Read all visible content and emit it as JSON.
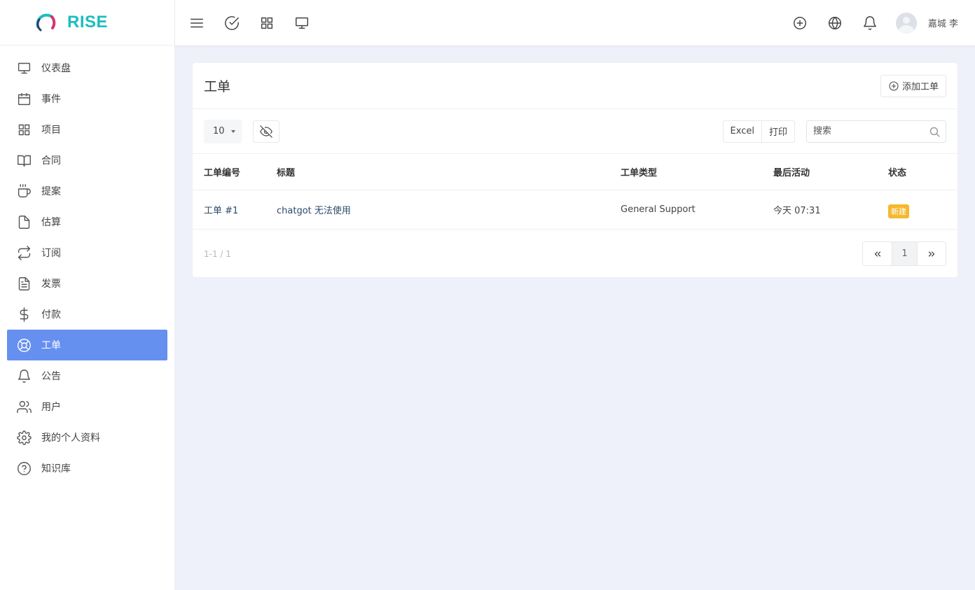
{
  "brand": {
    "name": "RISE",
    "colors": {
      "teal": "#1bbdbf",
      "accent": "#6690f0",
      "badge": "#f5b82e"
    }
  },
  "sidebar": {
    "items": [
      {
        "label": "仪表盘",
        "icon": "monitor-icon"
      },
      {
        "label": "事件",
        "icon": "calendar-icon"
      },
      {
        "label": "项目",
        "icon": "grid-icon"
      },
      {
        "label": "合同",
        "icon": "book-icon"
      },
      {
        "label": "提案",
        "icon": "coffee-icon"
      },
      {
        "label": "估算",
        "icon": "file-icon"
      },
      {
        "label": "订阅",
        "icon": "repeat-icon"
      },
      {
        "label": "发票",
        "icon": "file-text-icon"
      },
      {
        "label": "付款",
        "icon": "dollar-icon"
      },
      {
        "label": "工单",
        "icon": "life-buoy-icon",
        "active": true
      },
      {
        "label": "公告",
        "icon": "bell-icon"
      },
      {
        "label": "用户",
        "icon": "users-icon"
      },
      {
        "label": "我的个人资料",
        "icon": "settings-icon"
      },
      {
        "label": "知识库",
        "icon": "help-circle-icon"
      }
    ]
  },
  "topbar": {
    "left_icons": [
      "menu-icon",
      "check-circle-icon",
      "grid-icon",
      "monitor-icon"
    ],
    "right_icons": [
      "plus-circle-icon",
      "globe-icon",
      "bell-icon"
    ],
    "user_name": "嘉城 李"
  },
  "card": {
    "title": "工单",
    "add_button": "添加工单",
    "page_size": "10",
    "export": {
      "excel": "Excel",
      "print": "打印"
    },
    "search_placeholder": "搜索",
    "columns": [
      "工单编号",
      "标题",
      "工单类型",
      "最后活动",
      "状态"
    ],
    "rows": [
      {
        "id": "工单 #1",
        "title": "chatgot 无法使用",
        "type": "General Support",
        "last_activity": "今天 07:31",
        "status": "新建"
      }
    ],
    "summary": "1-1 / 1",
    "pager": {
      "current": "1"
    }
  }
}
